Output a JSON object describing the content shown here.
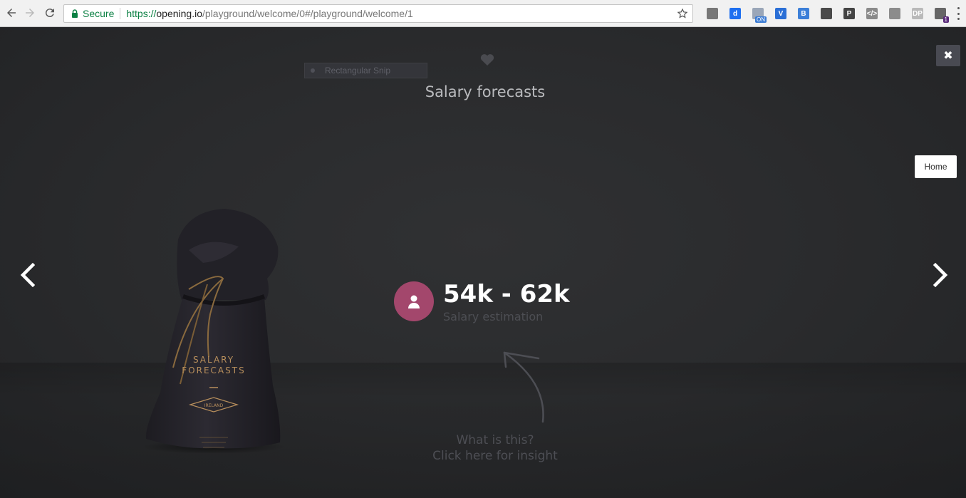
{
  "browser": {
    "secure_label": "Secure",
    "url_scheme": "https://",
    "url_host": "opening.io",
    "url_path": "/playground/welcome/0#/playground/welcome/1",
    "extensions": [
      {
        "name": "stack-icon",
        "glyph": "",
        "color": "#777777"
      },
      {
        "name": "d-icon",
        "glyph": "d",
        "color": "#1e6ff0"
      },
      {
        "name": "on-icon",
        "glyph": "",
        "color": "#9aa6b8",
        "badge": "ON",
        "badge_color": "#3a7bd5"
      },
      {
        "name": "v-icon",
        "glyph": "V",
        "color": "#2a6fd6"
      },
      {
        "name": "bracket-icon",
        "glyph": "B",
        "color": "#3c7fd8"
      },
      {
        "name": "evernote-icon",
        "glyph": "",
        "color": "#4a4a4a"
      },
      {
        "name": "p-icon",
        "glyph": "P",
        "color": "#444444"
      },
      {
        "name": "code-icon",
        "glyph": "</>",
        "color": "#8a8a8a"
      },
      {
        "name": "circle-icon",
        "glyph": "",
        "color": "#8c8c8c"
      },
      {
        "name": "dp-icon",
        "glyph": "DP",
        "color": "#b9b9b9"
      },
      {
        "name": "ghost-icon",
        "glyph": "",
        "color": "#666666",
        "badge": "1",
        "badge_color": "#5a2a7a"
      }
    ]
  },
  "snip": {
    "label": "Rectangular Snip"
  },
  "page": {
    "title": "Salary forecasts",
    "home_label": "Home",
    "close_glyph": "✖"
  },
  "stat": {
    "value": "54k - 62k",
    "label": "Salary estimation"
  },
  "insight": {
    "line1": "What is this?",
    "line2": "Click here for insight"
  },
  "bag": {
    "title_line1": "SALARY",
    "title_line2": "FORECASTS",
    "badge": "IRELAND"
  },
  "colors": {
    "accent": "#a3476c",
    "background": "#2a2b2d"
  }
}
